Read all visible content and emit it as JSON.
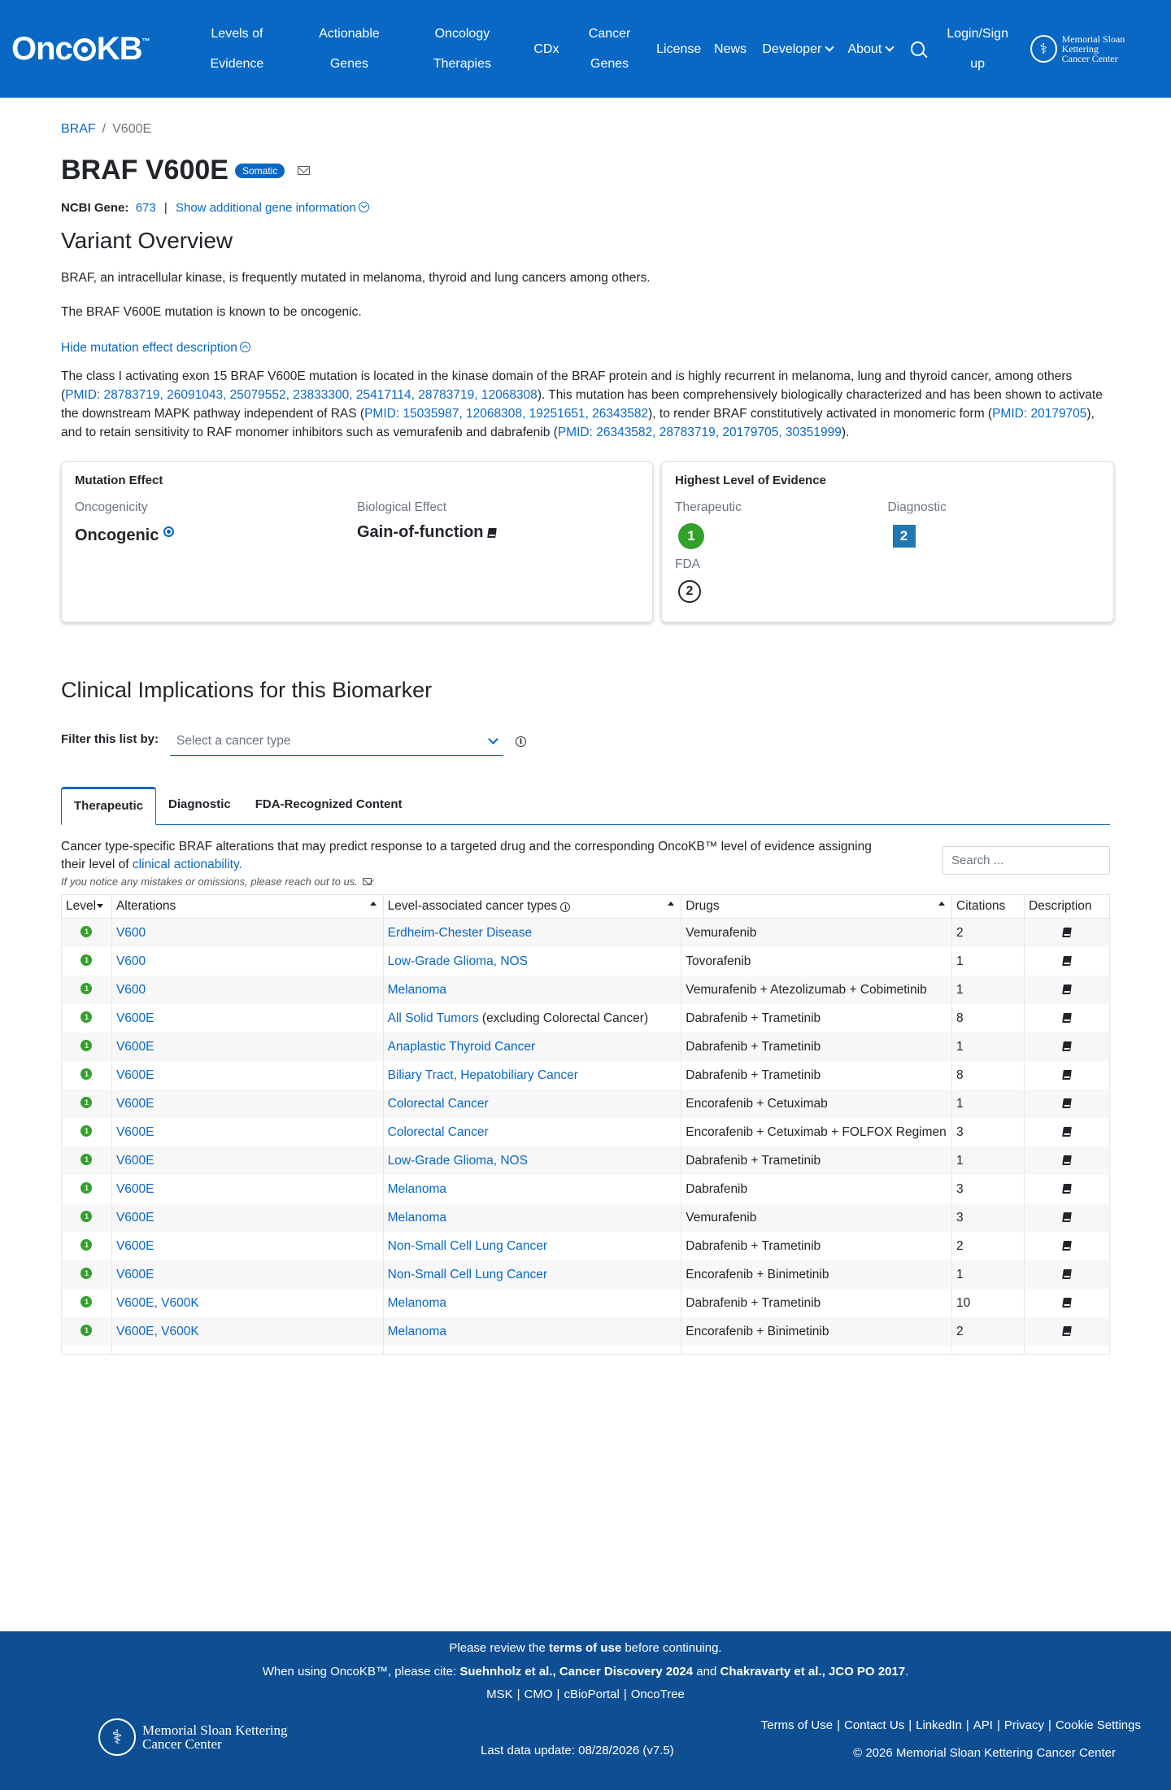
{
  "nav": {
    "brand": "OncoKB",
    "items": [
      {
        "label": "Levels of Evidence",
        "l1": "Levels of",
        "l2": "Evidence"
      },
      {
        "label": "Actionable Genes",
        "l1": "Actionable",
        "l2": "Genes"
      },
      {
        "label": "Oncology Therapies",
        "l1": "Oncology",
        "l2": "Therapies"
      },
      {
        "label": "CDx"
      },
      {
        "label": "Cancer Genes",
        "l1": "Cancer",
        "l2": "Genes"
      },
      {
        "label": "License"
      },
      {
        "label": "News"
      },
      {
        "label": "Developer"
      },
      {
        "label": "About"
      }
    ],
    "login_l1": "Login/Sign",
    "login_l2": "up",
    "msk_line1": "Memorial Sloan Kettering",
    "msk_line2": "Cancer Center"
  },
  "breadcrumb": {
    "gene": "BRAF",
    "sep": "/",
    "variant": "V600E"
  },
  "page_title": "BRAF V600E",
  "badge": "Somatic",
  "gene_info": {
    "label": "NCBI Gene:",
    "id": "673",
    "sep": "|",
    "toggle": "Show additional gene information"
  },
  "overview": {
    "heading": "Variant Overview",
    "summary": "BRAF, an intracellular kinase, is frequently mutated in melanoma, thyroid and lung cancers among others.",
    "oncogenic_statement": "The BRAF V600E mutation is known to be oncogenic.",
    "hide_toggle": "Hide mutation effect description",
    "desc_1": "The class I activating exon 15 BRAF V600E mutation is located in the kinase domain of the BRAF protein and is highly recurrent in melanoma, lung and thyroid cancer, among others (",
    "pmid_1": "PMID: 28783719, 26091043, 25079552, 23833300, 25417114, 28783719, 12068308",
    "desc_2": "). This mutation has been comprehensively biologically characterized and has been shown to activate the downstream MAPK pathway independent of RAS (",
    "pmid_2": "PMID: 15035987, 12068308, 19251651, 26343582",
    "desc_3": "), to render BRAF constitutively activated in monomeric form (",
    "pmid_3": "PMID: 20179705",
    "desc_4": "), and to retain sensitivity to RAF monomer inhibitors such as vemurafenib and dabrafenib (",
    "pmid_4": "PMID: 26343582, 28783719, 20179705, 30351999",
    "desc_5": ")."
  },
  "mutation_effect": {
    "title": "Mutation Effect",
    "oncogenicity_label": "Oncogenicity",
    "oncogenicity_value": "Oncogenic",
    "bio_effect_label": "Biological Effect",
    "bio_effect_value": "Gain-of-function"
  },
  "highest_level": {
    "title": "Highest Level of Evidence",
    "therapeutic_label": "Therapeutic",
    "therapeutic_value": "1",
    "diagnostic_label": "Diagnostic",
    "diagnostic_value": "2",
    "fda_label": "FDA",
    "fda_value": "2",
    "colors": {
      "level1": "#33a02c",
      "dx2": "#1f78b4"
    }
  },
  "clinical": {
    "heading": "Clinical Implications for this Biomarker",
    "filter_label": "Filter this list by:",
    "filter_placeholder": "Select a cancer type",
    "tabs": [
      "Therapeutic",
      "Diagnostic",
      "FDA-Recognized Content"
    ],
    "caption_1": "Cancer type-specific BRAF alterations that may predict response to a targeted drug and the corresponding OncoKB™ level of evidence assigning their level of ",
    "caption_link": "clinical actionability.",
    "note": "If you notice any mistakes or omissions, please reach out to us.",
    "search_placeholder": "Search ...",
    "columns": {
      "level": "Level",
      "alterations": "Alterations",
      "cancer_types": "Level-associated cancer types",
      "drugs": "Drugs",
      "citations": "Citations",
      "description": "Description"
    },
    "rows": [
      {
        "level": "1",
        "alteration": "V600",
        "cancer_type": "Erdheim-Chester Disease",
        "extra": "",
        "drugs": "Vemurafenib",
        "citations": "2"
      },
      {
        "level": "1",
        "alteration": "V600",
        "cancer_type": "Low-Grade Glioma, NOS",
        "extra": "",
        "drugs": "Tovorafenib",
        "citations": "1"
      },
      {
        "level": "1",
        "alteration": "V600",
        "cancer_type": "Melanoma",
        "extra": "",
        "drugs": "Vemurafenib + Atezolizumab + Cobimetinib",
        "citations": "1"
      },
      {
        "level": "1",
        "alteration": "V600E",
        "cancer_type": "All Solid Tumors",
        "extra": " (excluding Colorectal Cancer)",
        "drugs": "Dabrafenib + Trametinib",
        "citations": "8"
      },
      {
        "level": "1",
        "alteration": "V600E",
        "cancer_type": "Anaplastic Thyroid Cancer",
        "extra": "",
        "drugs": "Dabrafenib + Trametinib",
        "citations": "1"
      },
      {
        "level": "1",
        "alteration": "V600E",
        "cancer_type": "Biliary Tract, Hepatobiliary Cancer",
        "extra": "",
        "drugs": "Dabrafenib + Trametinib",
        "citations": "8"
      },
      {
        "level": "1",
        "alteration": "V600E",
        "cancer_type": "Colorectal Cancer",
        "extra": "",
        "drugs": "Encorafenib + Cetuximab",
        "citations": "1"
      },
      {
        "level": "1",
        "alteration": "V600E",
        "cancer_type": "Colorectal Cancer",
        "extra": "",
        "drugs": "Encorafenib + Cetuximab + FOLFOX Regimen",
        "citations": "3"
      },
      {
        "level": "1",
        "alteration": "V600E",
        "cancer_type": "Low-Grade Glioma, NOS",
        "extra": "",
        "drugs": "Dabrafenib + Trametinib",
        "citations": "1"
      },
      {
        "level": "1",
        "alteration": "V600E",
        "cancer_type": "Melanoma",
        "extra": "",
        "drugs": "Dabrafenib",
        "citations": "3"
      },
      {
        "level": "1",
        "alteration": "V600E",
        "cancer_type": "Melanoma",
        "extra": "",
        "drugs": "Vemurafenib",
        "citations": "3"
      },
      {
        "level": "1",
        "alteration": "V600E",
        "cancer_type": "Non-Small Cell Lung Cancer",
        "extra": "",
        "drugs": "Dabrafenib + Trametinib",
        "citations": "2"
      },
      {
        "level": "1",
        "alteration": "V600E",
        "cancer_type": "Non-Small Cell Lung Cancer",
        "extra": "",
        "drugs": "Encorafenib + Binimetinib",
        "citations": "1"
      },
      {
        "level": "1",
        "alteration": "V600E, V600K",
        "cancer_type": "Melanoma",
        "extra": "",
        "drugs": "Dabrafenib + Trametinib",
        "citations": "10"
      },
      {
        "level": "1",
        "alteration": "V600E, V600K",
        "cancer_type": "Melanoma",
        "extra": "",
        "drugs": "Encorafenib + Binimetinib",
        "citations": "2"
      }
    ]
  },
  "footer": {
    "review_1": "Please review the ",
    "terms_link": "terms of use",
    "review_2": " before continuing.",
    "cite_1": "When using OncoKB™, please cite: ",
    "cite_a": "Suehnholz et al., Cancer Discovery 2024",
    "cite_and": " and ",
    "cite_b": "Chakravarty et al., JCO PO 2017",
    "cite_end": ".",
    "partner_links": [
      "MSK",
      "CMO",
      "cBioPortal",
      "OncoTree"
    ],
    "links": [
      "Terms of Use",
      "Contact Us",
      "LinkedIn",
      "API",
      "Privacy",
      "Cookie Settings"
    ],
    "last_update": "Last data update: 08/28/2026 (v7.5)",
    "copyright": "© 2026 Memorial Sloan Kettering Cancer Center"
  },
  "colors": {
    "brand_blue": "#0968c3",
    "footer_blue": "#0e4f94",
    "level1_green": "#33a02c"
  }
}
